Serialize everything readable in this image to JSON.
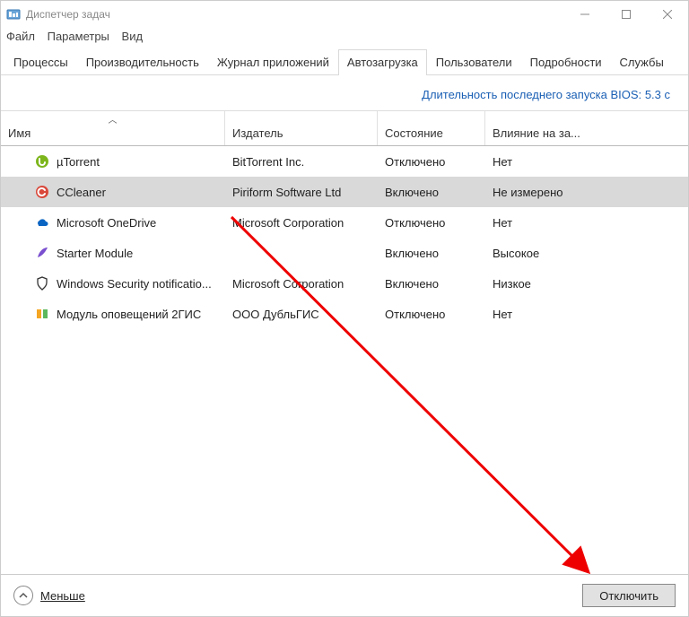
{
  "window": {
    "title": "Диспетчер задач"
  },
  "menu": {
    "file": "Файл",
    "options": "Параметры",
    "view": "Вид"
  },
  "tabs": {
    "items": [
      "Процессы",
      "Производительность",
      "Журнал приложений",
      "Автозагрузка",
      "Пользователи",
      "Подробности",
      "Службы"
    ],
    "active_index": 3
  },
  "bios": {
    "label": "Длительность последнего запуска BIOS:",
    "value": "5.3 с"
  },
  "columns": {
    "name": "Имя",
    "publisher": "Издатель",
    "status": "Состояние",
    "impact": "Влияние на за..."
  },
  "rows": [
    {
      "icon": "utorrent",
      "name": "µTorrent",
      "publisher": "BitTorrent Inc.",
      "status": "Отключено",
      "impact": "Нет",
      "selected": false
    },
    {
      "icon": "ccleaner",
      "name": "CCleaner",
      "publisher": "Piriform Software Ltd",
      "status": "Включено",
      "impact": "Не измерено",
      "selected": true
    },
    {
      "icon": "onedrive",
      "name": "Microsoft OneDrive",
      "publisher": "Microsoft Corporation",
      "status": "Отключено",
      "impact": "Нет",
      "selected": false
    },
    {
      "icon": "feather",
      "name": "Starter Module",
      "publisher": "",
      "status": "Включено",
      "impact": "Высокое",
      "selected": false
    },
    {
      "icon": "shield",
      "name": "Windows Security notificatio...",
      "publisher": "Microsoft Corporation",
      "status": "Включено",
      "impact": "Низкое",
      "selected": false
    },
    {
      "icon": "2gis",
      "name": "Модуль оповещений 2ГИС",
      "publisher": "ООО ДубльГИС",
      "status": "Отключено",
      "impact": "Нет",
      "selected": false
    }
  ],
  "footer": {
    "fewer": "Меньше",
    "disable": "Отключить"
  }
}
